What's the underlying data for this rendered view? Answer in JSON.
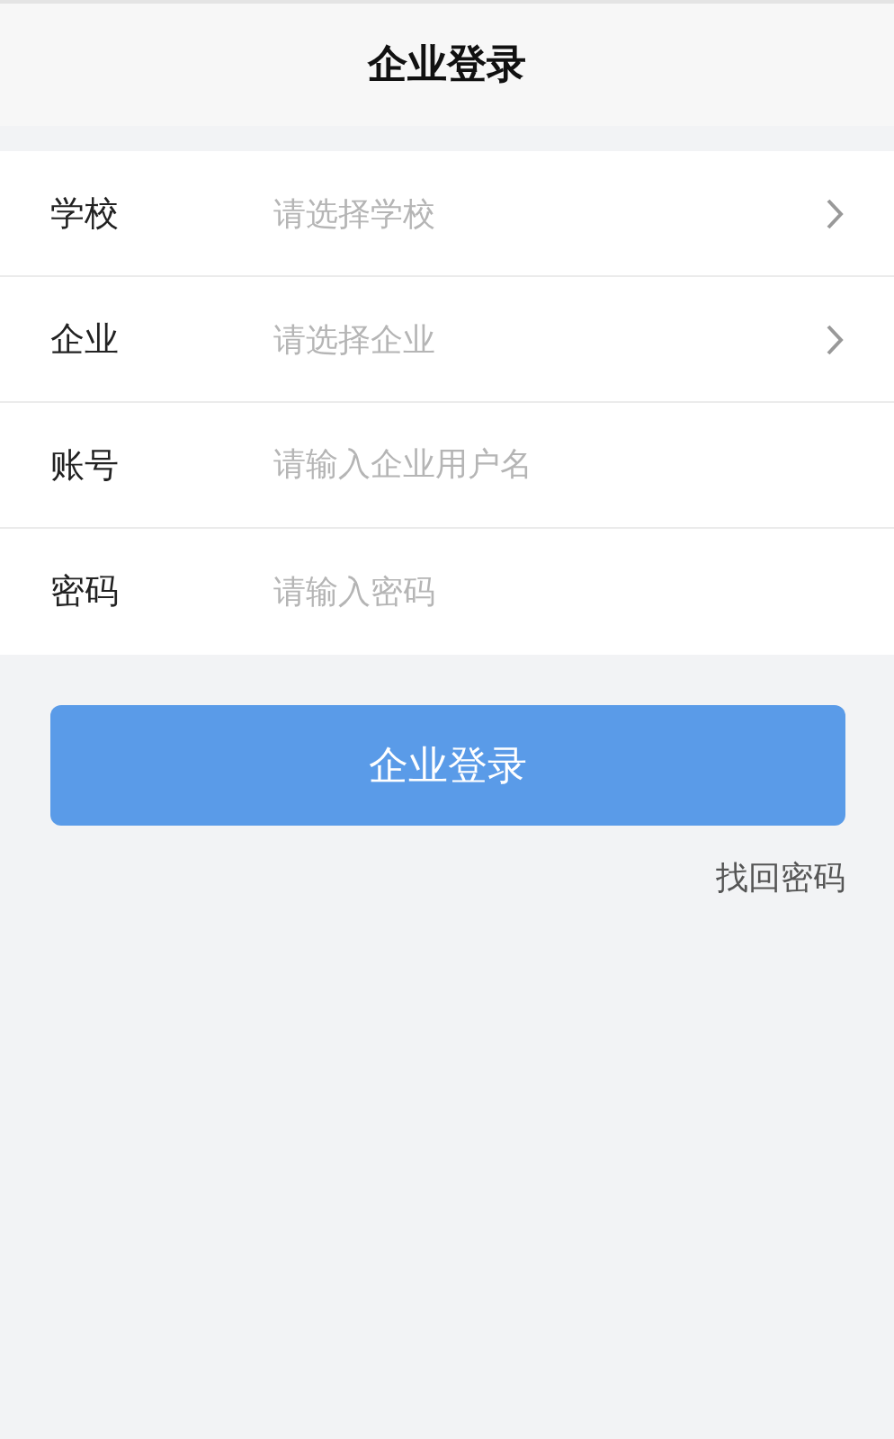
{
  "header": {
    "title": "企业登录"
  },
  "form": {
    "fields": [
      {
        "label": "学校",
        "placeholder": "请选择学校",
        "kind": "select"
      },
      {
        "label": "企业",
        "placeholder": "请选择企业",
        "kind": "select"
      },
      {
        "label": "账号",
        "placeholder": "请输入企业用户名",
        "kind": "input"
      },
      {
        "label": "密码",
        "placeholder": "请输入密码",
        "kind": "password"
      }
    ]
  },
  "login_button": "企业登录",
  "forgot_password_link": "找回密码"
}
